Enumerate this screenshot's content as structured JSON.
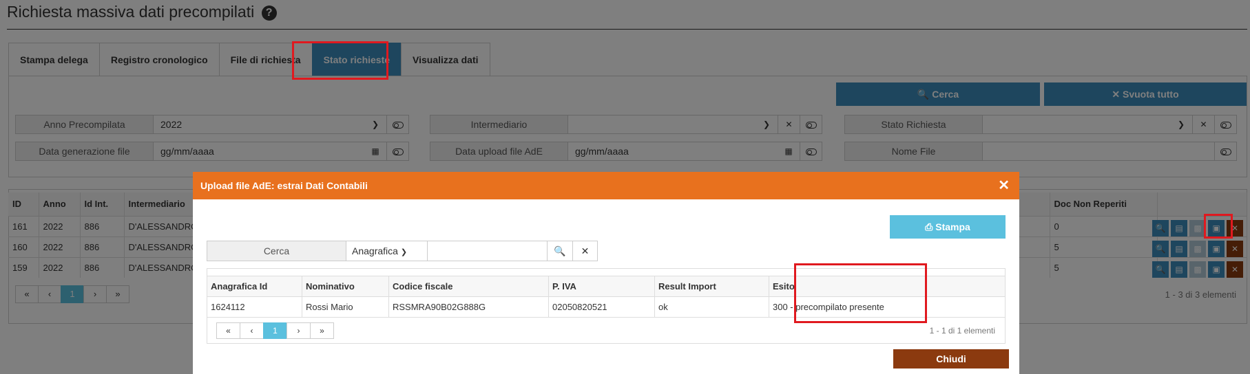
{
  "page": {
    "title": "Richiesta massiva dati precompilati",
    "help_icon": "?"
  },
  "tabs": [
    {
      "label": "Stampa delega"
    },
    {
      "label": "Registro cronologico"
    },
    {
      "label": "File di richiesta"
    },
    {
      "label": "Stato richieste",
      "active": true
    },
    {
      "label": "Visualizza dati"
    }
  ],
  "filters": {
    "search_label": "Cerca",
    "clear_label": "Svuota tutto",
    "anno_label": "Anno Precompilata",
    "anno_value": "2022",
    "intermediario_label": "Intermediario",
    "intermediario_value": "",
    "stato_label": "Stato Richiesta",
    "stato_value": "",
    "data_gen_label": "Data generazione file",
    "data_gen_placeholder": "gg/mm/aaaa",
    "data_upload_label": "Data upload file AdE",
    "data_upload_placeholder": "gg/mm/aaaa",
    "nome_file_label": "Nome File",
    "nome_file_value": ""
  },
  "bg_table": {
    "columns": [
      "ID",
      "Anno",
      "Id Int.",
      "Intermediario",
      "Doc Non Reperiti"
    ],
    "rows": [
      {
        "id": "161",
        "anno": "2022",
        "idint": "886",
        "intermediario": "D'ALESSANDRO",
        "docnr": "0"
      },
      {
        "id": "160",
        "anno": "2022",
        "idint": "886",
        "intermediario": "D'ALESSANDRO",
        "docnr": "5"
      },
      {
        "id": "159",
        "anno": "2022",
        "idint": "886",
        "intermediario": "D'ALESSANDRO",
        "docnr": "5"
      }
    ],
    "pager": {
      "first": "«",
      "prev": "‹",
      "current": "1",
      "next": "›",
      "last": "»"
    },
    "count_text": "1 - 3 di 3 elementi"
  },
  "modal": {
    "title": "Upload file AdE: estrai Dati Contabili",
    "close_icon": "✕",
    "print_label": "Stampa",
    "search_label": "Cerca",
    "search_select_value": "Anagrafica",
    "search_input_value": "",
    "columns": [
      "Anagrafica Id",
      "Nominativo",
      "Codice fiscale",
      "P. IVA",
      "Result Import",
      "Esito"
    ],
    "rows": [
      {
        "anagrafica_id": "1624112",
        "nominativo": "Rossi Mario",
        "codice_fiscale": "RSSMRA90B02G888G",
        "piva": "02050820521",
        "result_import": "ok",
        "esito": "300 - precompilato presente"
      }
    ],
    "pager": {
      "first": "«",
      "prev": "‹",
      "current": "1",
      "next": "›",
      "last": "»"
    },
    "count_text": "1 - 1 di 1 elementi",
    "close_label": "Chiudi"
  },
  "colors": {
    "primary": "#3c8dbc",
    "info": "#5bc0de",
    "modal_header": "#e8711e",
    "danger_dark": "#8b3a0f",
    "highlight": "#e0191f"
  }
}
